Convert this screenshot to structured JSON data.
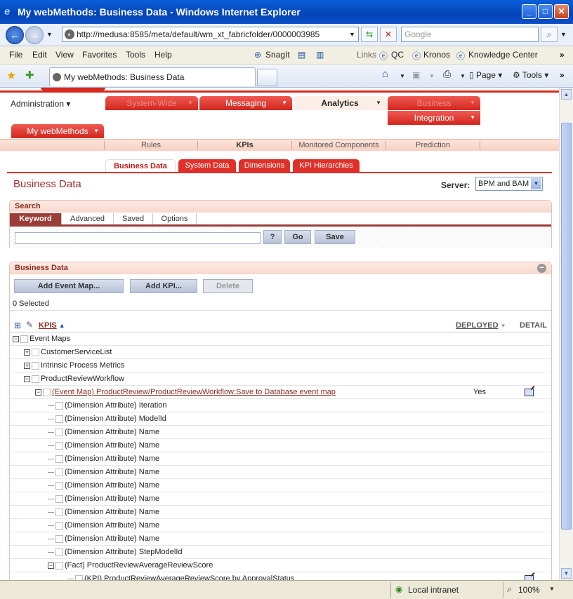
{
  "browser": {
    "title": "My webMethods: Business Data - Windows Internet Explorer",
    "url": "http://medusa:8585/meta/default/wm_xt_fabricfolder/0000003985",
    "search_placeholder": "Google",
    "menu": [
      "File",
      "Edit",
      "View",
      "Favorites",
      "Tools",
      "Help"
    ],
    "links_toolbar": [
      "SnagIt",
      "Links",
      "QC",
      "Kronos",
      "Knowledge Center"
    ],
    "tab_title": "My webMethods: Business Data",
    "tools": {
      "page": "Page",
      "tools": "Tools"
    },
    "status": {
      "zone": "Local intranet",
      "zoom": "100%"
    }
  },
  "app": {
    "admin_menu": "Administration",
    "nav": [
      {
        "label": "System-Wide"
      },
      {
        "label": "Messaging"
      },
      {
        "label": "Analytics"
      },
      {
        "label": "Business"
      },
      {
        "label": "Integration"
      },
      {
        "label": "My webMethods"
      }
    ],
    "subnav": [
      "Rules",
      "KPIs",
      "Monitored Components",
      "Prediction"
    ],
    "page_tabs": [
      "Business Data",
      "System Data",
      "Dimensions",
      "KPI Hierarchies"
    ],
    "page_title": "Business Data",
    "server_label": "Server:",
    "server_value": "BPM and BAM",
    "search": {
      "title": "Search",
      "tabs": [
        "Keyword",
        "Advanced",
        "Saved",
        "Options"
      ],
      "help_btn": "?",
      "go_btn": "Go",
      "save_btn": "Save"
    },
    "business": {
      "title": "Business Data",
      "add_event_map": "Add Event Map...",
      "add_kpi": "Add KPI...",
      "delete": "Delete",
      "selected": "0 Selected",
      "col_kpis": "KPIS",
      "col_deployed": "DEPLOYED",
      "col_detail": "DETAIL"
    },
    "tree": [
      {
        "text": "Event Maps",
        "toggle": "−",
        "indent": 0
      },
      {
        "text": "CustomerServiceList",
        "toggle": "+",
        "indent": 1
      },
      {
        "text": "Intrinsic Process Metrics",
        "toggle": "+",
        "indent": 1
      },
      {
        "text": "ProductReviewWorkflow",
        "toggle": "−",
        "indent": 1
      },
      {
        "text": "(Event Map) ProductReview/ProductReviewWorkflow:Save to Database event map",
        "toggle": "−",
        "indent": 2,
        "link": true,
        "deployed": "Yes",
        "detail": true
      },
      {
        "text": "(Dimension Attribute) Iteration",
        "indent": 3
      },
      {
        "text": "(Dimension Attribute) ModelId",
        "indent": 3
      },
      {
        "text": "(Dimension Attribute) Name",
        "indent": 3
      },
      {
        "text": "(Dimension Attribute) Name",
        "indent": 3
      },
      {
        "text": "(Dimension Attribute) Name",
        "indent": 3
      },
      {
        "text": "(Dimension Attribute) Name",
        "indent": 3
      },
      {
        "text": "(Dimension Attribute) Name",
        "indent": 3
      },
      {
        "text": "(Dimension Attribute) Name",
        "indent": 3
      },
      {
        "text": "(Dimension Attribute) Name",
        "indent": 3
      },
      {
        "text": "(Dimension Attribute) Name",
        "indent": 3
      },
      {
        "text": "(Dimension Attribute) Name",
        "indent": 3
      },
      {
        "text": "(Dimension Attribute) StepModelId",
        "indent": 3
      },
      {
        "text": "(Fact) ProductReviewAverageReviewScore",
        "toggle": "−",
        "indent": 3
      },
      {
        "text": "(KPI) ProductReviewAverageReviewScore by ApprovalStatus",
        "indent": 4,
        "detail": true
      }
    ]
  }
}
